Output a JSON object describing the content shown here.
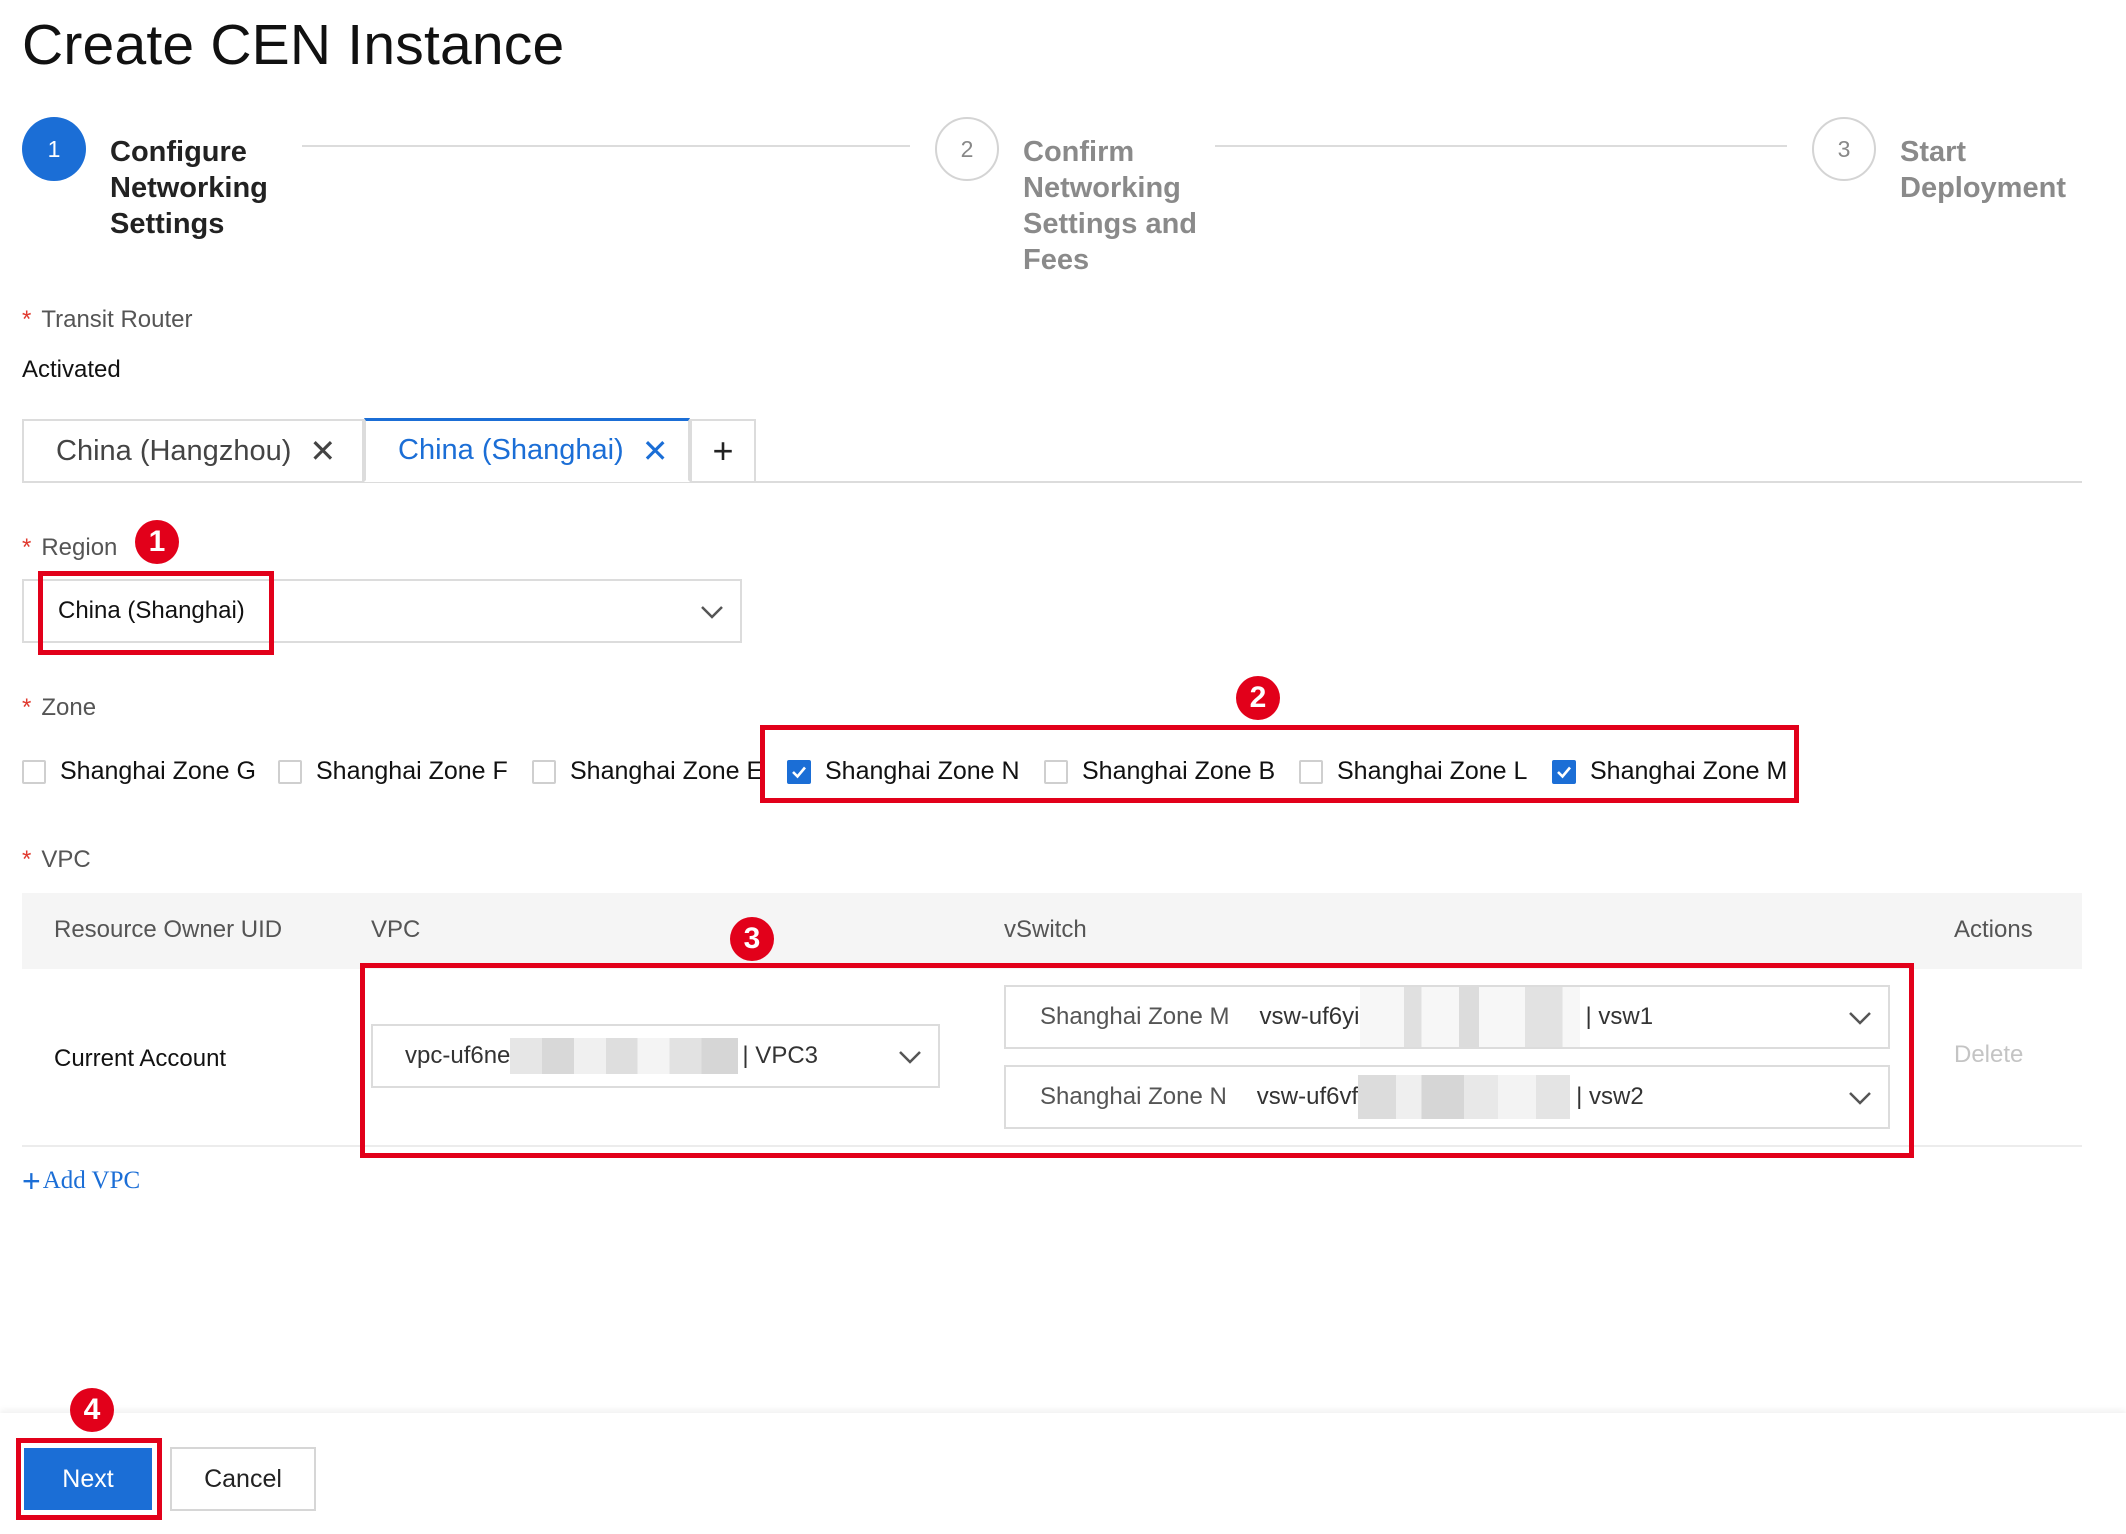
{
  "page": {
    "title": "Create CEN Instance"
  },
  "steps": [
    {
      "number": "1",
      "title": "Configure Networking Settings",
      "state": "active"
    },
    {
      "number": "2",
      "title": "Confirm Networking Settings and Fees",
      "state": "pending"
    },
    {
      "number": "3",
      "title": "Start Deployment",
      "state": "pending"
    }
  ],
  "transit_router": {
    "label": "Transit Router",
    "required_mark": "*",
    "value": "Activated"
  },
  "tabs": [
    {
      "label": "China (Hangzhou)",
      "close_icon": "close-icon",
      "active": false
    },
    {
      "label": "China (Shanghai)",
      "close_icon": "close-icon",
      "active": true
    }
  ],
  "add_tab": {
    "label": "+"
  },
  "region": {
    "label": "Region",
    "required_mark": "*",
    "selected": "China (Shanghai)"
  },
  "zone": {
    "label": "Zone",
    "required_mark": "*",
    "options": [
      {
        "label": "Shanghai Zone G",
        "checked": false
      },
      {
        "label": "Shanghai Zone F",
        "checked": false
      },
      {
        "label": "Shanghai Zone E",
        "checked": false
      },
      {
        "label": "Shanghai Zone N",
        "checked": true
      },
      {
        "label": "Shanghai Zone B",
        "checked": false
      },
      {
        "label": "Shanghai Zone L",
        "checked": false
      },
      {
        "label": "Shanghai Zone M",
        "checked": true
      }
    ]
  },
  "vpc": {
    "label": "VPC",
    "required_mark": "*",
    "columns": [
      "Resource Owner UID",
      "VPC",
      "vSwitch",
      "Actions"
    ],
    "row": {
      "owner": "Current Account",
      "vpc_prefix": "vpc-uf6ne",
      "vpc_suffix": "| VPC3",
      "vswitches": [
        {
          "zone": "Shanghai Zone M",
          "id_prefix": "vsw-uf6yi",
          "name_suffix": "| vsw1"
        },
        {
          "zone": "Shanghai Zone N",
          "id_prefix": "vsw-uf6vf",
          "name_suffix": "| vsw2"
        }
      ],
      "action": "Delete"
    },
    "add_label": "Add VPC"
  },
  "annotations": [
    "1",
    "2",
    "3",
    "4"
  ],
  "footer": {
    "next_label": "Next",
    "cancel_label": "Cancel"
  },
  "colors": {
    "accent": "#1b6ed6",
    "annotation": "#e2001a",
    "required": "#e03a2f"
  }
}
